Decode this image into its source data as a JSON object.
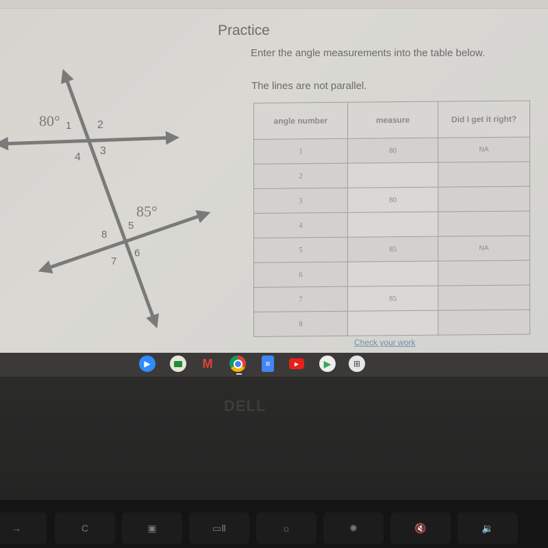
{
  "page": {
    "title": "Practice",
    "instruction": "Enter the angle measurements into the table below.",
    "note": "The lines are not parallel.",
    "check_link": "Check your work"
  },
  "diagram": {
    "given_angle_top": "80°",
    "given_angle_bottom": "85°",
    "angle_labels": [
      "1",
      "2",
      "3",
      "4",
      "5",
      "6",
      "7",
      "8"
    ]
  },
  "table": {
    "headers": [
      "angle number",
      "measure",
      "Did I get it right?"
    ],
    "rows": [
      {
        "angle": "1",
        "measure": "80",
        "result": "NA"
      },
      {
        "angle": "2",
        "measure": "",
        "result": ""
      },
      {
        "angle": "3",
        "measure": "80",
        "result": ""
      },
      {
        "angle": "4",
        "measure": "",
        "result": ""
      },
      {
        "angle": "5",
        "measure": "85",
        "result": "NA"
      },
      {
        "angle": "6",
        "measure": "",
        "result": ""
      },
      {
        "angle": "7",
        "measure": "85",
        "result": ""
      },
      {
        "angle": "8",
        "measure": "",
        "result": ""
      }
    ]
  },
  "shelf": {
    "apps": [
      {
        "name": "zoom",
        "color": "#2d8cff"
      },
      {
        "name": "google-classroom",
        "color": "#e9e6d6"
      },
      {
        "name": "gmail",
        "color": "#e34133"
      },
      {
        "name": "chrome",
        "color": "#4285f4"
      },
      {
        "name": "google-docs",
        "color": "#4285f4"
      },
      {
        "name": "youtube",
        "color": "#e62117"
      },
      {
        "name": "play-store",
        "color": "#eeeeee"
      },
      {
        "name": "kiosk",
        "color": "#e6e6e6"
      }
    ]
  },
  "hardware": {
    "brand": "DELL",
    "keys": [
      "→",
      "C",
      "▣",
      "▭Ⅱ",
      "☼",
      "✺",
      "🔇",
      "🔉"
    ]
  }
}
